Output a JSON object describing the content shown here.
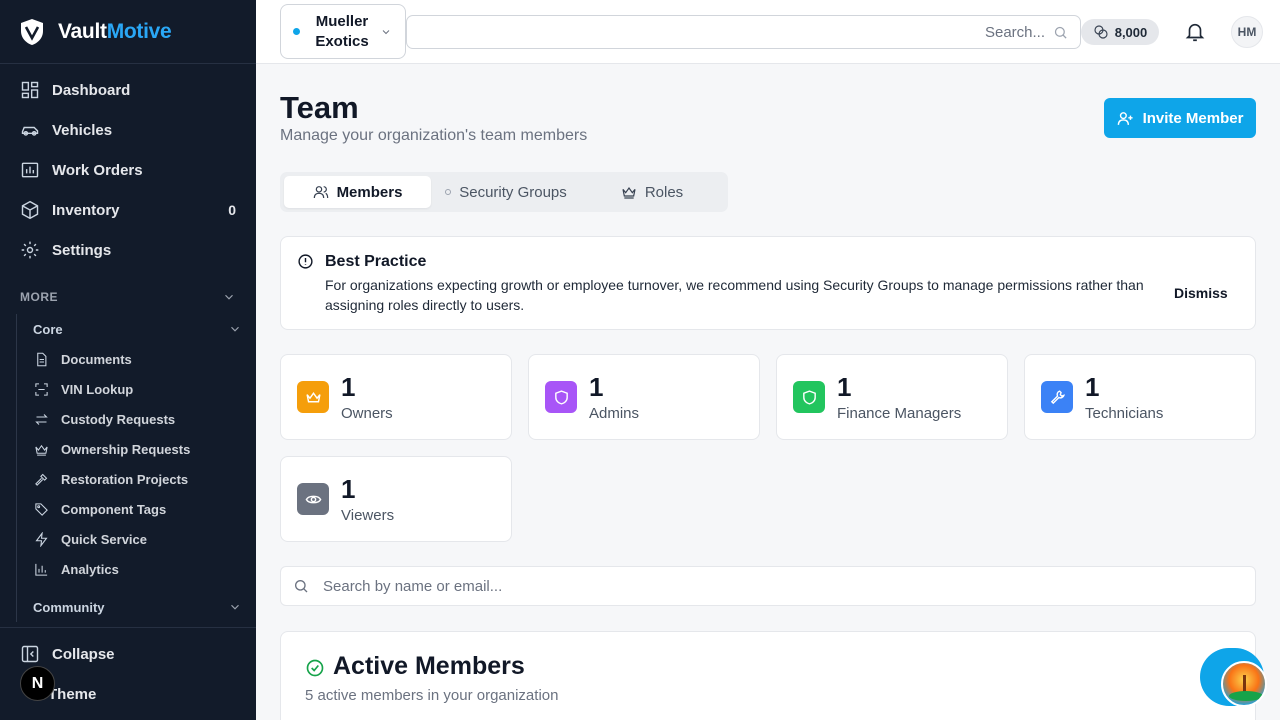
{
  "brand": {
    "part1": "Vault",
    "part2": "Motive"
  },
  "sidebar": {
    "items": [
      {
        "label": "Dashboard",
        "icon": "dashboard-icon"
      },
      {
        "label": "Vehicles",
        "icon": "car-icon"
      },
      {
        "label": "Work Orders",
        "icon": "work-orders-icon"
      },
      {
        "label": "Inventory",
        "icon": "box-icon",
        "badge": "0"
      },
      {
        "label": "Settings",
        "icon": "gear-icon"
      }
    ],
    "more_label": "MORE",
    "core_label": "Core",
    "core_items": [
      {
        "label": "Documents",
        "icon": "document-icon"
      },
      {
        "label": "VIN Lookup",
        "icon": "scan-icon"
      },
      {
        "label": "Custody Requests",
        "icon": "swap-icon"
      },
      {
        "label": "Ownership Requests",
        "icon": "crown-icon"
      },
      {
        "label": "Restoration Projects",
        "icon": "hammer-icon"
      },
      {
        "label": "Component Tags",
        "icon": "tag-icon"
      },
      {
        "label": "Quick Service",
        "icon": "bolt-icon"
      },
      {
        "label": "Analytics",
        "icon": "chart-icon"
      }
    ],
    "community_label": "Community",
    "collapse_label": "Collapse",
    "theme_label": "Theme",
    "n_badge": "N"
  },
  "header": {
    "org_name": "Mueller Exotics",
    "search_placeholder": "Search...",
    "credits": "8,000",
    "avatar_initials": "HM"
  },
  "page": {
    "title": "Team",
    "subtitle": "Manage your organization's team members",
    "invite_label": "Invite Member",
    "tabs": [
      {
        "label": "Members",
        "active": true
      },
      {
        "label": "Security Groups",
        "active": false
      },
      {
        "label": "Roles",
        "active": false
      }
    ],
    "alert": {
      "title": "Best Practice",
      "body": "For organizations expecting growth or employee turnover, we recommend using Security Groups to manage permissions rather than assigning roles directly to users.",
      "dismiss_label": "Dismiss"
    },
    "stats": [
      {
        "count": "1",
        "label": "Owners",
        "color": "#f59e0b",
        "icon": "crown-icon"
      },
      {
        "count": "1",
        "label": "Admins",
        "color": "#a855f7",
        "icon": "shield-icon"
      },
      {
        "count": "1",
        "label": "Finance Managers",
        "color": "#22c55e",
        "icon": "shield-icon"
      },
      {
        "count": "1",
        "label": "Technicians",
        "color": "#3b82f6",
        "icon": "wrench-icon"
      },
      {
        "count": "1",
        "label": "Viewers",
        "color": "#6b7280",
        "icon": "eye-icon"
      }
    ],
    "member_search_placeholder": "Search by name or email...",
    "active_members": {
      "title": "Active Members",
      "subtitle": "5 active members in your organization"
    }
  },
  "colors": {
    "accent": "#0ea5e9",
    "sidebar_bg": "#121b2a"
  }
}
